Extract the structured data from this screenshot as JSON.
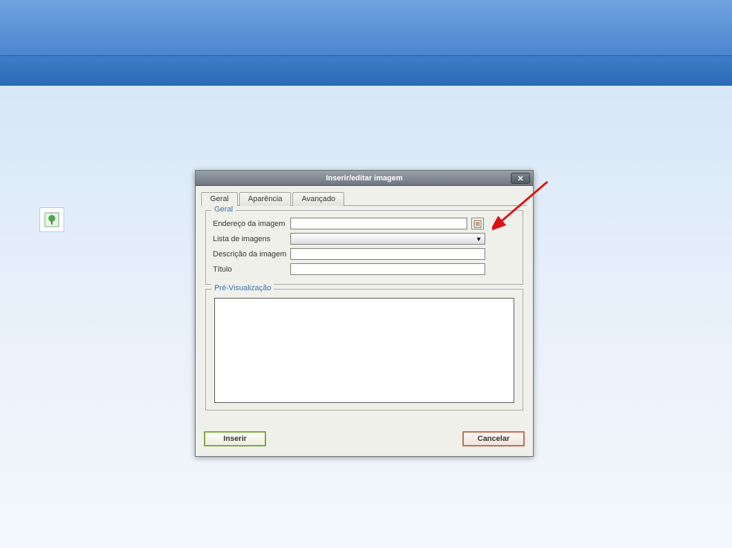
{
  "dialog": {
    "title": "Inserir/editar imagem",
    "tabs": [
      "Geral",
      "Aparência",
      "Avançado"
    ],
    "fieldset_general": "Geral",
    "fieldset_preview": "Pré-Visualização",
    "labels": {
      "url": "Endereço da imagem",
      "list": "Lista de imagens",
      "desc": "Descrição da imagem",
      "title": "Título"
    },
    "fields": {
      "url": "",
      "list_selected": "",
      "desc": "",
      "title": ""
    },
    "buttons": {
      "insert": "Inserir",
      "cancel": "Cancelar"
    }
  }
}
